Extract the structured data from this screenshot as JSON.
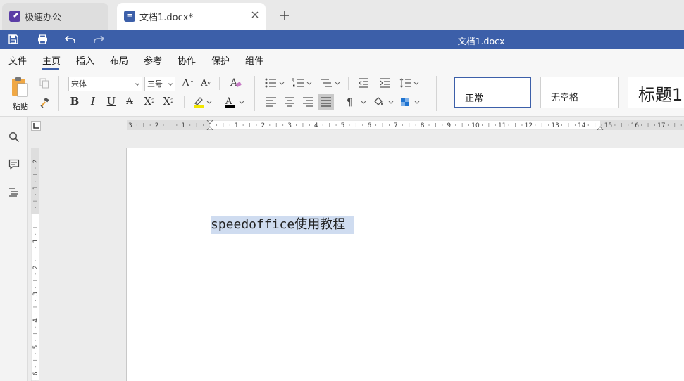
{
  "tabs": [
    {
      "label": "极速办公",
      "color": "#5b3ea6"
    },
    {
      "label": "文档1.docx*",
      "color": "#3c5fa9"
    }
  ],
  "window": {
    "title": "文档1.docx"
  },
  "menu": [
    "文件",
    "主页",
    "插入",
    "布局",
    "参考",
    "协作",
    "保护",
    "组件"
  ],
  "active_menu": "主页",
  "toolbar": {
    "paste_label": "粘贴",
    "font_name": "宋体",
    "font_size": "三号",
    "grow_font": "A",
    "shrink_font": "A",
    "bold": "B",
    "italic": "I",
    "underline": "U",
    "strike": "A",
    "superscript": "X",
    "subscript": "X",
    "font_color": "A",
    "highlight_color": "#f2e600",
    "font_color_value": "#000000"
  },
  "styles": [
    {
      "label": "正常",
      "selected": true
    },
    {
      "label": "无空格",
      "selected": false
    },
    {
      "label": "标题1",
      "selected": false
    }
  ],
  "ruler": {
    "h_left": [
      "3",
      "2",
      "1"
    ],
    "h_right": [
      "1",
      "2",
      "3",
      "4",
      "5",
      "6",
      "7",
      "8",
      "9",
      "10",
      "11",
      "12",
      "13",
      "14",
      "15",
      "16",
      "17"
    ],
    "v": [
      "2",
      "1",
      "1",
      "2",
      "3",
      "4",
      "5",
      "6"
    ]
  },
  "document": {
    "text": "speedoffice使用教程",
    "selection_color": "#cfdcf0"
  },
  "colors": {
    "accent": "#3c5fa9"
  }
}
